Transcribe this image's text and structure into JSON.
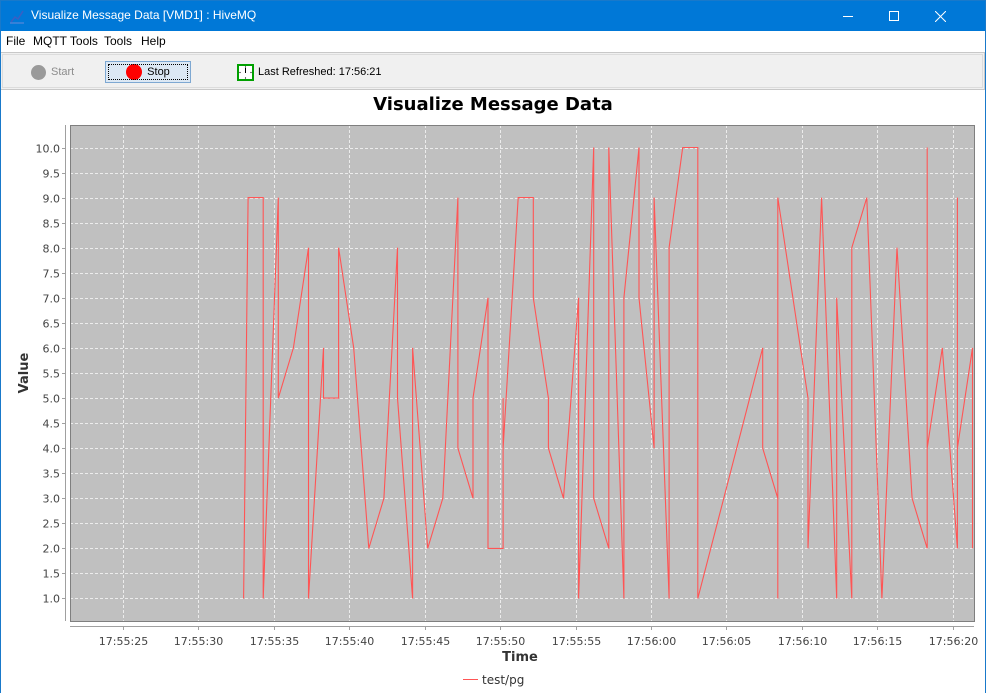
{
  "window": {
    "title": "Visualize Message Data [VMD1] : HiveMQ",
    "controls": [
      "minimize",
      "maximize",
      "close"
    ]
  },
  "menu": {
    "items": [
      "File",
      "MQTT Tools",
      "Tools",
      "Help"
    ]
  },
  "toolbar": {
    "start_label": "Start",
    "stop_label": "Stop",
    "last_refreshed_label": "Last Refreshed: 17:56:21",
    "colors": {
      "stop": "#ff0000",
      "start_disabled": "#9a9a9a",
      "clock_border": "#00a000"
    }
  },
  "chart_data": {
    "type": "line",
    "title": "Visualize Message Data",
    "xlabel": "Time",
    "ylabel": "Value",
    "x_unit": "seconds after 17:55:25",
    "xlim": [
      -3.5,
      56.4
    ],
    "ylim": [
      0.55,
      10.45
    ],
    "y_ticks": [
      1.0,
      1.5,
      2.0,
      2.5,
      3.0,
      3.5,
      4.0,
      4.5,
      5.0,
      5.5,
      6.0,
      6.5,
      7.0,
      7.5,
      8.0,
      8.5,
      9.0,
      9.5,
      10.0
    ],
    "y_tick_labels": [
      "1.0",
      "1.5",
      "2.0",
      "2.5",
      "3.0",
      "3.5",
      "4.0",
      "4.5",
      "5.0",
      "5.5",
      "6.0",
      "6.5",
      "7.0",
      "7.5",
      "8.0",
      "8.5",
      "9.0",
      "9.5",
      "10.0"
    ],
    "x_ticks": [
      0,
      5,
      10,
      15,
      20,
      25,
      30,
      35,
      40,
      45,
      50,
      55
    ],
    "x_tick_labels": [
      "17:55:25",
      "17:55:30",
      "17:55:35",
      "17:55:40",
      "17:55:45",
      "17:55:50",
      "17:55:55",
      "17:56:00",
      "17:56:05",
      "17:56:10",
      "17:56:15",
      "17:56:20"
    ],
    "grid": true,
    "background": "#c0c0c0",
    "legend": {
      "position": "bottom-center",
      "entries": [
        "test/pg"
      ]
    },
    "series": [
      {
        "name": "test/pg",
        "color": "#ff5555",
        "points": [
          [
            8.0,
            1
          ],
          [
            8.3,
            9
          ],
          [
            9.3,
            9
          ],
          [
            9.3,
            1
          ],
          [
            10.3,
            9
          ],
          [
            10.3,
            5
          ],
          [
            11.3,
            6
          ],
          [
            12.3,
            8
          ],
          [
            12.3,
            1
          ],
          [
            13.3,
            6
          ],
          [
            13.3,
            5
          ],
          [
            14.3,
            5
          ],
          [
            14.3,
            8
          ],
          [
            15.3,
            6
          ],
          [
            16.3,
            2
          ],
          [
            17.3,
            3
          ],
          [
            18.2,
            8
          ],
          [
            18.2,
            5
          ],
          [
            19.2,
            1
          ],
          [
            19.2,
            6
          ],
          [
            20.2,
            2
          ],
          [
            21.2,
            3
          ],
          [
            22.2,
            9
          ],
          [
            22.2,
            4
          ],
          [
            23.2,
            3
          ],
          [
            23.2,
            5
          ],
          [
            24.2,
            7
          ],
          [
            24.2,
            2
          ],
          [
            25.2,
            2
          ],
          [
            25.2,
            5
          ],
          [
            25.2,
            4
          ],
          [
            26.2,
            9
          ],
          [
            27.2,
            9
          ],
          [
            27.2,
            7
          ],
          [
            28.2,
            5
          ],
          [
            28.2,
            4
          ],
          [
            29.2,
            3
          ],
          [
            30.2,
            7
          ],
          [
            30.2,
            1
          ],
          [
            31.2,
            10
          ],
          [
            31.2,
            3
          ],
          [
            32.2,
            2
          ],
          [
            32.2,
            10
          ],
          [
            33.2,
            1
          ],
          [
            33.2,
            7
          ],
          [
            34.2,
            10
          ],
          [
            34.2,
            7
          ],
          [
            35.2,
            4
          ],
          [
            35.2,
            9
          ],
          [
            36.2,
            1
          ],
          [
            36.2,
            8
          ],
          [
            37.1,
            10
          ],
          [
            38.1,
            10
          ],
          [
            38.1,
            1
          ],
          [
            42.4,
            6
          ],
          [
            42.4,
            4
          ],
          [
            43.4,
            3
          ],
          [
            43.4,
            1
          ],
          [
            43.4,
            9
          ],
          [
            45.4,
            5
          ],
          [
            45.4,
            2
          ],
          [
            46.3,
            9
          ],
          [
            47.3,
            1
          ],
          [
            47.3,
            7
          ],
          [
            48.3,
            1
          ],
          [
            48.3,
            8
          ],
          [
            49.3,
            9
          ],
          [
            50.3,
            1
          ],
          [
            51.3,
            8
          ],
          [
            52.3,
            3
          ],
          [
            53.3,
            2
          ],
          [
            53.3,
            10
          ],
          [
            53.3,
            4
          ],
          [
            54.3,
            6
          ],
          [
            55.3,
            2
          ],
          [
            55.3,
            9
          ],
          [
            55.3,
            4
          ],
          [
            56.3,
            6
          ],
          [
            56.3,
            2
          ]
        ]
      }
    ]
  }
}
